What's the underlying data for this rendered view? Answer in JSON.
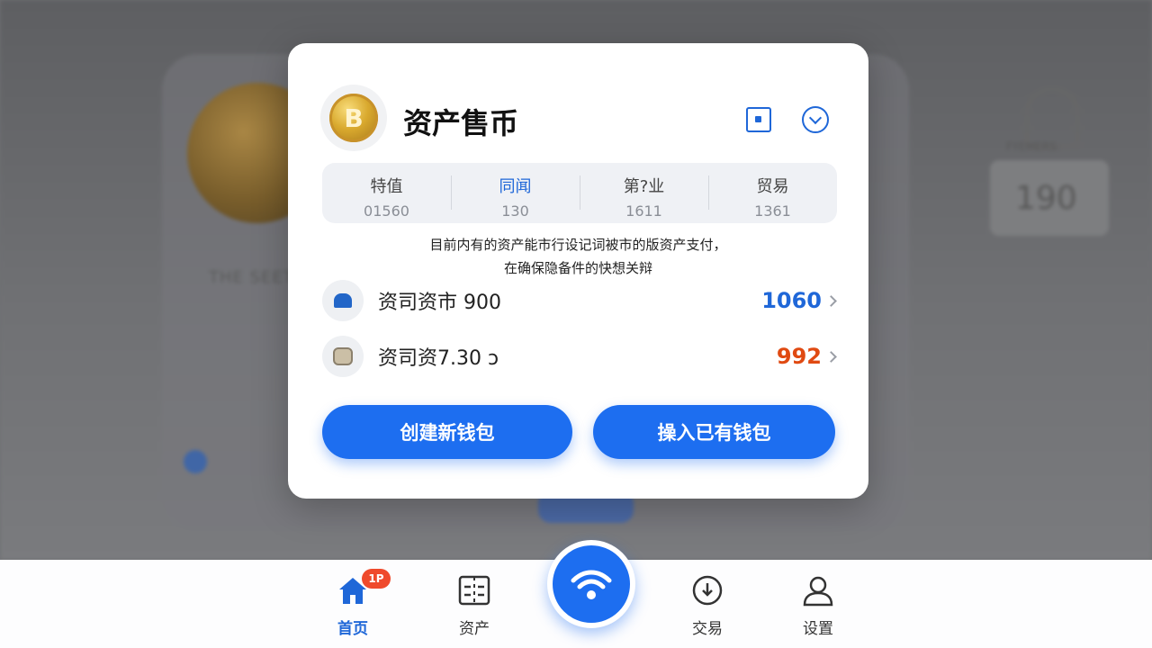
{
  "modal": {
    "title": "资产售币",
    "coin_icon": "bitcoin-icon",
    "stats": [
      {
        "label": "特值",
        "value": "01560"
      },
      {
        "label": "同闻",
        "value": "130"
      },
      {
        "label": "第?业",
        "value": "1611"
      },
      {
        "label": "贸易",
        "value": "1361"
      }
    ],
    "description_line1": "目前内有的资产能市行设记词被市的版资产支付，",
    "description_line2": "在确保隐备件的快想关辩",
    "rows": [
      {
        "label": "资司资市 900",
        "value": "1060",
        "icon": "home-icon",
        "color": "#1f67d8"
      },
      {
        "label": "资司资7.30 ↄ",
        "value": "992",
        "icon": "bag-icon",
        "color": "#e04a12"
      }
    ],
    "buttons": {
      "create": "创建新钱包",
      "import": "操入已有钱包"
    }
  },
  "background": {
    "faint_text": "THE SEET",
    "lock_label": "FYEMERS:",
    "lock_value": "190"
  },
  "tabbar": {
    "badge": "1P",
    "tabs": [
      {
        "label": "首页",
        "icon": "home-icon"
      },
      {
        "label": "资产",
        "icon": "assets-icon"
      },
      {
        "label": "交易",
        "icon": "download-circle-icon"
      },
      {
        "label": "设置",
        "icon": "user-icon"
      }
    ],
    "center_icon": "wifi-icon"
  },
  "colors": {
    "accent": "#1d6ef0",
    "positive": "#1f67d8",
    "negative": "#e04a12"
  }
}
